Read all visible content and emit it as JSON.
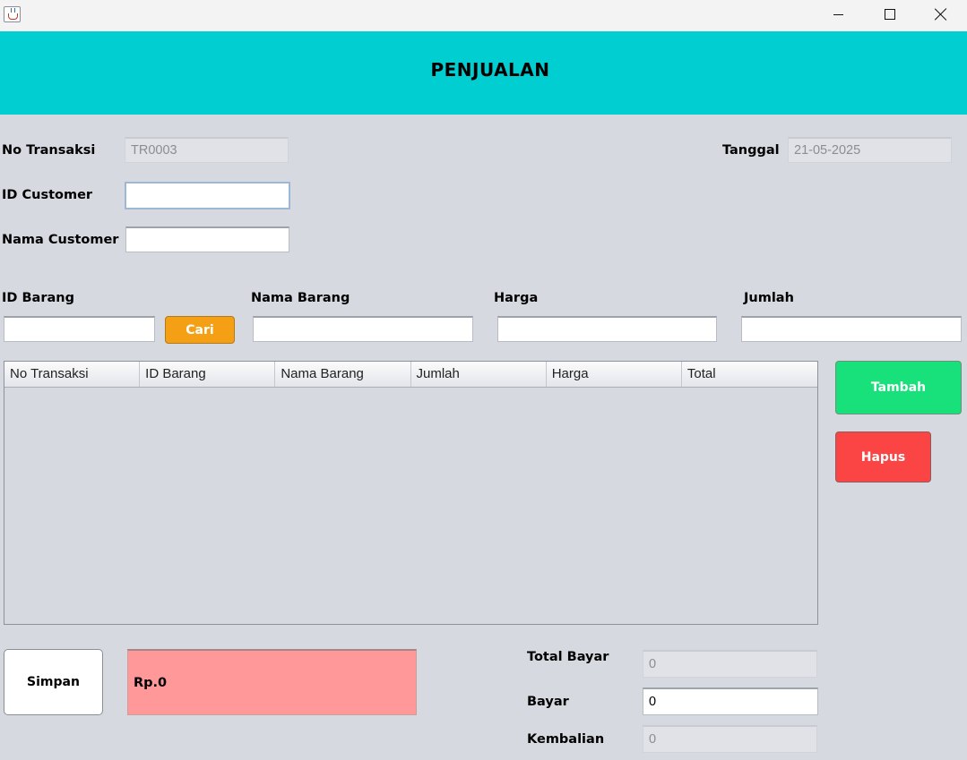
{
  "window": {
    "icon": "java-cup-icon"
  },
  "header": {
    "title": "PENJUALAN",
    "color": "#00ced1"
  },
  "form": {
    "no_transaksi": {
      "label": "No Transaksi",
      "value": "TR0003"
    },
    "tanggal": {
      "label": "Tanggal",
      "value": "21-05-2025"
    },
    "id_customer": {
      "label": "ID Customer",
      "value": ""
    },
    "nama_customer": {
      "label": "Nama Customer",
      "value": ""
    }
  },
  "item": {
    "id_barang": {
      "label": "ID Barang",
      "value": ""
    },
    "cari_label": "Cari",
    "nama_barang": {
      "label": "Nama Barang",
      "value": ""
    },
    "harga": {
      "label": "Harga",
      "value": ""
    },
    "jumlah": {
      "label": "Jumlah",
      "value": ""
    }
  },
  "table": {
    "columns": [
      "No Transaksi",
      "ID Barang",
      "Nama Barang",
      "Jumlah",
      "Harga",
      "Total"
    ],
    "rows": []
  },
  "actions": {
    "tambah_label": "Tambah",
    "hapus_label": "Hapus",
    "simpan_label": "Simpan"
  },
  "summary": {
    "display": "Rp.0",
    "total_bayar": {
      "label": "Total Bayar",
      "value": "0"
    },
    "bayar": {
      "label": "Bayar",
      "value": "0"
    },
    "kembalian": {
      "label": "Kembalian",
      "value": "0"
    }
  },
  "colors": {
    "cari": "#f5a014",
    "tambah": "#18e07a",
    "hapus": "#fb4444",
    "display": "#ff9999"
  }
}
